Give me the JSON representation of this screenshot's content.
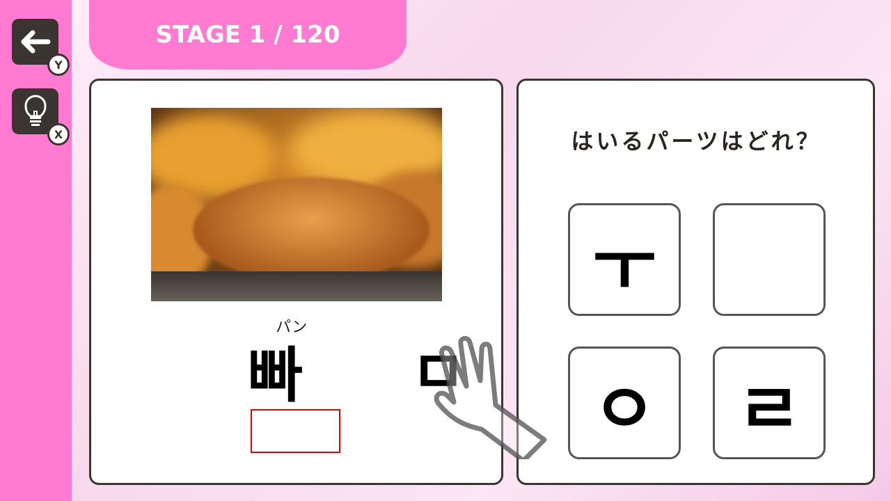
{
  "sidebar": {
    "back": {
      "icon": "arrow-left-icon",
      "key": "Y"
    },
    "hint": {
      "icon": "lightbulb-icon",
      "key": "X"
    }
  },
  "header": {
    "stage": "STAGE 1 / 120"
  },
  "puzzle": {
    "image": "croissant-photo",
    "reading": "パン",
    "word": "빠",
    "dragging_piece": "ㅁ"
  },
  "question": {
    "text": "はいるパーツはどれ？",
    "options": [
      "ㅜ",
      "",
      "ㅇ",
      "ㄹ"
    ]
  },
  "colors": {
    "accent": "#ff7ad0",
    "dark": "#3a3530",
    "slot": "#ee0000"
  }
}
